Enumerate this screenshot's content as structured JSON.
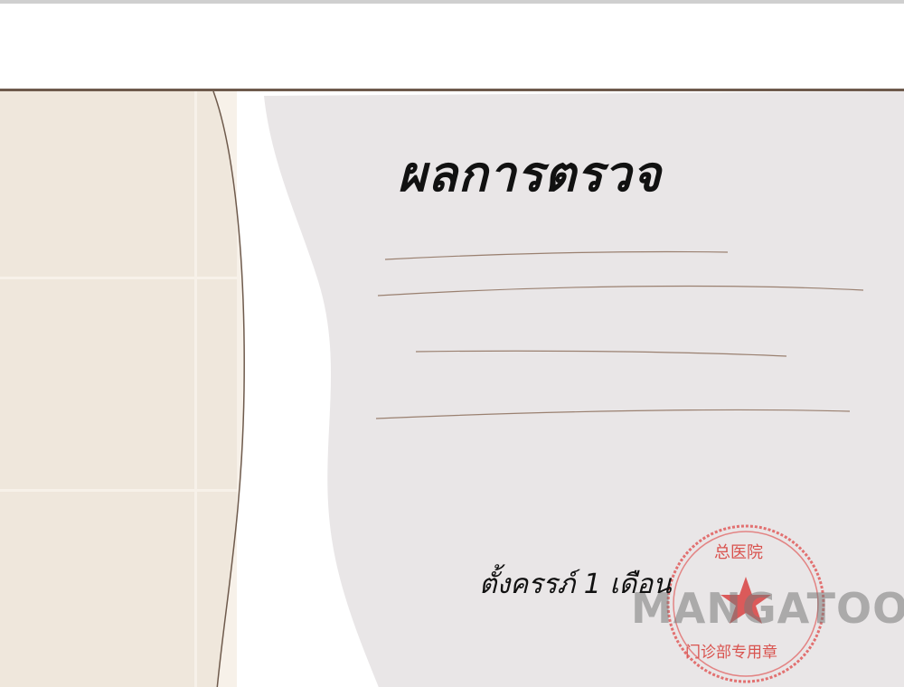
{
  "document": {
    "title": "ผลการตรวจ",
    "result": "ตั้งครรภ์ 1 เดือน"
  },
  "stamp": {
    "top_text": "总医院",
    "bottom_text": "门诊部专用章",
    "star_icon": "star-icon",
    "color": "#e05a5a"
  },
  "watermark": {
    "text": "MANGATOON"
  },
  "colors": {
    "paper": "#e9e6e7",
    "wall": "#efe7dc",
    "frame": "#6e5a4c"
  }
}
